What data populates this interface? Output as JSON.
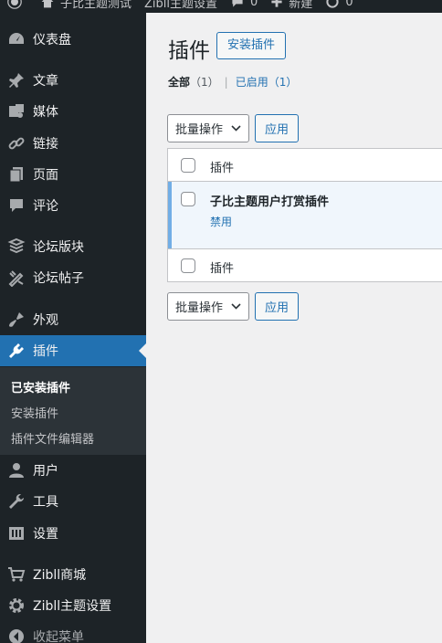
{
  "adminbar": {
    "site_name": "子比主题测试",
    "theme_settings": "Zibll主题设置",
    "comments_count": "0",
    "new_label": "新建",
    "updates_count": "0"
  },
  "sidebar": {
    "items": [
      {
        "label": "仪表盘",
        "icon": "dashboard-icon"
      },
      {
        "label": "文章",
        "icon": "pin-icon"
      },
      {
        "label": "媒体",
        "icon": "media-icon"
      },
      {
        "label": "链接",
        "icon": "link-icon"
      },
      {
        "label": "页面",
        "icon": "page-icon"
      },
      {
        "label": "评论",
        "icon": "comment-icon"
      },
      {
        "label": "论坛版块",
        "icon": "forum-icon"
      },
      {
        "label": "论坛帖子",
        "icon": "forum-post-icon"
      },
      {
        "label": "外观",
        "icon": "appearance-icon"
      },
      {
        "label": "插件",
        "icon": "plugin-icon"
      },
      {
        "label": "用户",
        "icon": "user-icon"
      },
      {
        "label": "工具",
        "icon": "wrench-icon"
      },
      {
        "label": "设置",
        "icon": "settings-icon"
      },
      {
        "label": "Zibll商城",
        "icon": "cart-icon"
      },
      {
        "label": "Zibll主题设置",
        "icon": "gear-icon"
      },
      {
        "label": "收起菜单",
        "icon": "collapse-icon"
      }
    ],
    "submenu": [
      {
        "label": "已安装插件"
      },
      {
        "label": "安装插件"
      },
      {
        "label": "插件文件编辑器"
      }
    ]
  },
  "main": {
    "title": "插件",
    "add_new": "安装插件",
    "filters": {
      "all": "全部",
      "all_count": "（1）",
      "separator": "|",
      "active": "已启用",
      "active_count": "（1）"
    },
    "bulk_action": "批量操作",
    "apply": "应用",
    "table": {
      "header": "插件",
      "footer": "插件",
      "plugins": [
        {
          "name": "子比主题用户打赏插件",
          "action": "禁用"
        }
      ]
    }
  },
  "colors": {
    "sidebar_bg": "#1d2327",
    "accent": "#2271b1",
    "active_row_bg": "#f0f6fc",
    "active_row_border": "#72aee6"
  }
}
